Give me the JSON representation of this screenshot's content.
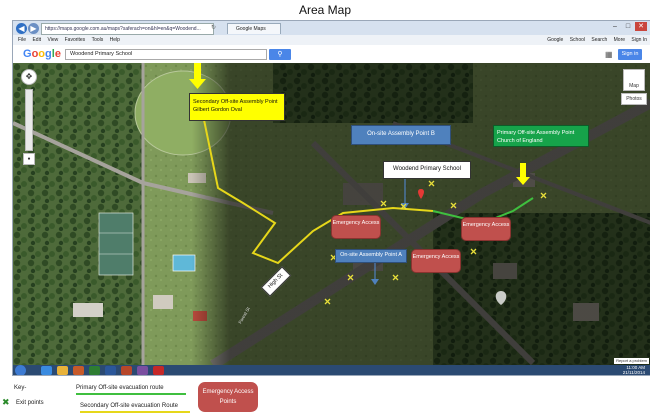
{
  "title": "Area Map",
  "browser": {
    "url": "https://maps.google.com.au/maps?saferach=on&hl=en&q=Woodend...",
    "tab_label": "Google Maps",
    "menu_items": [
      "File",
      "Edit",
      "View",
      "Favorites",
      "Tools",
      "Help"
    ],
    "menu_right": [
      "Google",
      "School",
      "Search",
      "More",
      "Sign In"
    ]
  },
  "google_bar": {
    "logo": "Google",
    "search_value": "Woodend Primary School",
    "sign_in_label": "Sign in"
  },
  "map": {
    "controls": {
      "map_label": "Map",
      "photos_label": "Photos"
    },
    "labels": {
      "secondary_assembly": "Secondary Off-site Assembly Point Gilbert Gordon Oval",
      "onsite_b": "On-site Assembly Point B",
      "primary_assembly": "Primary Off-site Assembly Point Church of England",
      "school": "Woodend Primary School",
      "emergency_access_1": "Emergency Access",
      "emergency_access_2": "Emergency Access",
      "emergency_access_3": "Emergency Access",
      "onsite_a": "On-site Assembly Point A",
      "high_st": "High St",
      "forest_st": "Forest St"
    },
    "attribution": "Report a problem",
    "colors": {
      "primary_route": "#3fbf3f",
      "secondary_route": "#e6d71a",
      "emergency": "#c0504d",
      "onsite_box": "#4f81bd",
      "primary_box": "#16a34a",
      "secondary_box": "#ffff00"
    }
  },
  "taskbar": {
    "time": "11:00 AM",
    "date": "21/11/2014"
  },
  "key": {
    "key_label": "Key-",
    "exit_points_label": "Exit points",
    "primary_route_label": "Primary Off-site evacuation route",
    "secondary_route_label": "Secondary Off-site evacuation Route",
    "emergency_label": "Emergency Access Points"
  }
}
